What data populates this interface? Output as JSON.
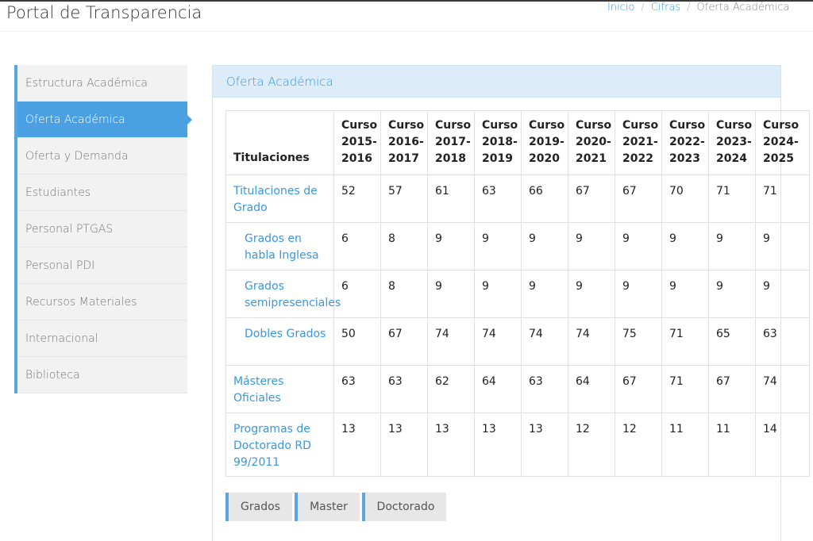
{
  "header": {
    "title": "Portal de Transparencia",
    "breadcrumb": {
      "home": "Inicio",
      "parent": "Cifras",
      "current": "Oferta Académica",
      "separator": "/"
    }
  },
  "sidebar": {
    "items": [
      {
        "label": "Estructura Académica",
        "active": false
      },
      {
        "label": "Oferta Académica",
        "active": true
      },
      {
        "label": "Oferta y Demanda",
        "active": false
      },
      {
        "label": "Estudiantes",
        "active": false
      },
      {
        "label": "Personal PTGAS",
        "active": false
      },
      {
        "label": "Personal PDI",
        "active": false
      },
      {
        "label": "Recursos Materiales",
        "active": false
      },
      {
        "label": "Internacional",
        "active": false
      },
      {
        "label": "Biblioteca",
        "active": false
      }
    ]
  },
  "panel": {
    "title": "Oferta Académica"
  },
  "table": {
    "header_label": "Titulaciones",
    "columns": [
      {
        "l1": "Curso",
        "l2": "2015-",
        "l3": "2016"
      },
      {
        "l1": "Curso",
        "l2": "2016-",
        "l3": "2017"
      },
      {
        "l1": "Curso",
        "l2": "2017-",
        "l3": "2018"
      },
      {
        "l1": "Curso",
        "l2": "2018-",
        "l3": "2019"
      },
      {
        "l1": "Curso",
        "l2": "2019-",
        "l3": "2020"
      },
      {
        "l1": "Curso",
        "l2": "2020-",
        "l3": "2021"
      },
      {
        "l1": "Curso",
        "l2": "2021-",
        "l3": "2022"
      },
      {
        "l1": "Curso",
        "l2": "2022-",
        "l3": "2023"
      },
      {
        "l1": "Curso",
        "l2": "2023-",
        "l3": "2024"
      },
      {
        "l1": "Curso",
        "l2": "2024-",
        "l3": "2025"
      }
    ],
    "rows": [
      {
        "name": "Titulaciones de Grado",
        "values": [
          "52",
          "57",
          "61",
          "63",
          "66",
          "67",
          "67",
          "70",
          "71",
          "71"
        ]
      },
      {
        "name": "Grados en habla Inglesa",
        "values": [
          "6",
          "8",
          "9",
          "9",
          "9",
          "9",
          "9",
          "9",
          "9",
          "9"
        ]
      },
      {
        "name": "Grados semipresenciales",
        "values": [
          "6",
          "8",
          "9",
          "9",
          "9",
          "9",
          "9",
          "9",
          "9",
          "9"
        ]
      },
      {
        "name": "Dobles Grados",
        "values": [
          "50",
          "67",
          "74",
          "74",
          "74",
          "74",
          "75",
          "71",
          "65",
          "63"
        ]
      },
      {
        "name": "Másteres Oficiales",
        "values": [
          "63",
          "63",
          "62",
          "64",
          "63",
          "64",
          "67",
          "71",
          "67",
          "74"
        ]
      },
      {
        "name": "Programas de Doctorado RD 99/2011",
        "values": [
          "13",
          "13",
          "13",
          "13",
          "13",
          "12",
          "12",
          "11",
          "11",
          "14"
        ]
      }
    ]
  },
  "tabs": {
    "grados": "Grados",
    "master": "Master",
    "doctorado": "Doctorado"
  },
  "colors": {
    "accent": "#3a97dd",
    "active_bg": "#4aa0e0",
    "panel_head_bg": "#dcecf8"
  }
}
